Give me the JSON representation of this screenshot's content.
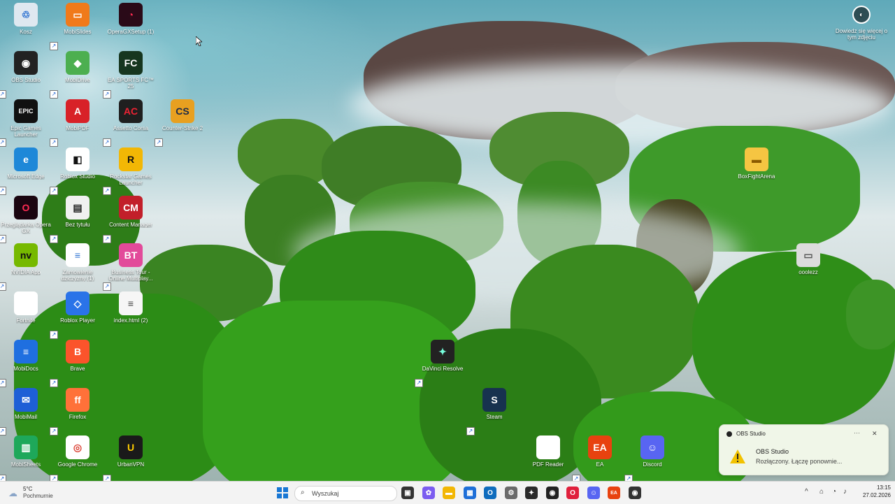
{
  "desktop": {
    "icons": [
      {
        "label": "Kosz",
        "badge": "♲",
        "bg": "#dfe8f0",
        "fg": "#2a6fd0",
        "shortcut": false
      },
      {
        "label": "MobiSlides",
        "badge": "▭",
        "bg": "#f07a1a",
        "fg": "#fff",
        "shortcut": true
      },
      {
        "label": "OperaGXSetup (1)",
        "badge": "◔",
        "bg": "#2a0a18",
        "fg": "#ff2b52",
        "shortcut": false
      },
      {
        "label": "OBS Studio",
        "badge": "◉",
        "bg": "#222",
        "fg": "#fff",
        "shortcut": true
      },
      {
        "label": "MobiDrive",
        "badge": "◆",
        "bg": "#4caf50",
        "fg": "#fff",
        "shortcut": true
      },
      {
        "label": "EA SPORTS FC™ 25",
        "badge": "FC",
        "bg": "#16361f",
        "fg": "#fff",
        "shortcut": true
      },
      {
        "label": "Epic Games Launcher",
        "badge": "EPIC",
        "bg": "#111",
        "fg": "#fff",
        "shortcut": true
      },
      {
        "label": "MobiPDF",
        "badge": "A",
        "bg": "#d82128",
        "fg": "#fff",
        "shortcut": true
      },
      {
        "label": "Assetto Corsa",
        "badge": "AC",
        "bg": "#1f1f1f",
        "fg": "#e23",
        "shortcut": true
      },
      {
        "label": "Counter-Strike 2",
        "badge": "CS",
        "bg": "#e8a020",
        "fg": "#1b2a4a",
        "shortcut": true
      },
      {
        "label": "Microsoft Edge",
        "badge": "e",
        "bg": "#1e88d8",
        "fg": "#fff",
        "shortcut": true
      },
      {
        "label": "Roblox Studio",
        "badge": "◧",
        "bg": "#fff",
        "fg": "#111",
        "shortcut": true
      },
      {
        "label": "Rockstar Games Launcher",
        "badge": "R",
        "bg": "#f2b705",
        "fg": "#111",
        "shortcut": true
      },
      {
        "label": "Przeglądarka Opera GX",
        "badge": "O",
        "bg": "#1a0510",
        "fg": "#ff2b52",
        "shortcut": true
      },
      {
        "label": "Bez tytułu",
        "badge": "▤",
        "bg": "#f0f0f0",
        "fg": "#222",
        "shortcut": true
      },
      {
        "label": "Content Manager",
        "badge": "CM",
        "bg": "#c21f2a",
        "fg": "#fff",
        "shortcut": true
      },
      {
        "label": "NVIDIA App",
        "badge": "nv",
        "bg": "#76b900",
        "fg": "#111",
        "shortcut": true
      },
      {
        "label": "Zamowienie dziczyzny (1)",
        "badge": "≡",
        "bg": "#ffffff",
        "fg": "#2a6fd0",
        "shortcut": false
      },
      {
        "label": "Business Tour - Online Multiplay...",
        "badge": "BT",
        "bg": "#e24a9a",
        "fg": "#fff",
        "shortcut": true
      },
      {
        "label": "Fortnite",
        "badge": "",
        "bg": "#ffffff",
        "fg": "#111",
        "shortcut": false
      },
      {
        "label": "Roblox Player",
        "badge": "◇",
        "bg": "#2a73e8",
        "fg": "#fff",
        "shortcut": true
      },
      {
        "label": "index.html (2)",
        "badge": "≡",
        "bg": "#f6f6f6",
        "fg": "#444",
        "shortcut": false
      },
      {
        "label": "MobiDocs",
        "badge": "≡",
        "bg": "#1f6fe0",
        "fg": "#fff",
        "shortcut": true
      },
      {
        "label": "Brave",
        "badge": "B",
        "bg": "#fb542b",
        "fg": "#fff",
        "shortcut": true
      },
      {
        "label": "MobiMail",
        "badge": "✉",
        "bg": "#1e5fd6",
        "fg": "#fff",
        "shortcut": true
      },
      {
        "label": "Firefox",
        "badge": "ff",
        "bg": "#ff7139",
        "fg": "#fff",
        "shortcut": true
      },
      {
        "label": "MobiSheets",
        "badge": "▥",
        "bg": "#1ea85a",
        "fg": "#fff",
        "shortcut": true
      },
      {
        "label": "Google Chrome",
        "badge": "◎",
        "bg": "#ffffff",
        "fg": "#db4437",
        "shortcut": true
      },
      {
        "label": "UrbanVPN",
        "badge": "U",
        "bg": "#1a1a1a",
        "fg": "#ffcc00",
        "shortcut": true
      },
      {
        "label": "DaVinci Resolve",
        "badge": "✦",
        "bg": "#222",
        "fg": "#7fd",
        "shortcut": true
      },
      {
        "label": "Steam",
        "badge": "S",
        "bg": "#17324f",
        "fg": "#fff",
        "shortcut": true
      },
      {
        "label": "PDF Reader",
        "badge": "",
        "bg": "#ffffff",
        "fg": "#111",
        "shortcut": false
      },
      {
        "label": "EA",
        "badge": "EA",
        "bg": "#e8420f",
        "fg": "#fff",
        "shortcut": true
      },
      {
        "label": "Discord",
        "badge": "☺",
        "bg": "#5865f2",
        "fg": "#fff",
        "shortcut": true
      },
      {
        "label": "BoxFightArena",
        "badge": "▬",
        "bg": "#f5c542",
        "fg": "#8a5a00",
        "shortcut": false
      },
      {
        "label": "ooolezz",
        "badge": "▭",
        "bg": "#dcdcdc",
        "fg": "#555",
        "shortcut": false
      }
    ],
    "learn_more": {
      "label": "Dowiedz się więcej o tym zdjęciu",
      "icon": "camera-icon"
    }
  },
  "notification": {
    "app_name": "OBS Studio",
    "title": "OBS Studio",
    "message": "Rozłączony. Łączę ponownie...",
    "more": "···",
    "close": "✕",
    "warning_color": "#f2c200"
  },
  "taskbar": {
    "weather_temp": "5°C",
    "weather_desc": "Pochmurnie",
    "search_placeholder": "Wyszukaj",
    "apps": [
      {
        "name": "task-view",
        "glyph": "▣",
        "bg": "#333"
      },
      {
        "name": "copilot",
        "glyph": "✿",
        "bg": "#7b5cf0"
      },
      {
        "name": "file-explorer",
        "glyph": "▬",
        "bg": "#f2b705"
      },
      {
        "name": "microsoft-store",
        "glyph": "▦",
        "bg": "#1e6fd8"
      },
      {
        "name": "outlook",
        "glyph": "O",
        "bg": "#0f6cbd"
      },
      {
        "name": "settings",
        "glyph": "⚙",
        "bg": "#6a6a6a"
      },
      {
        "name": "davinci-resolve",
        "glyph": "✦",
        "bg": "#2a2a2a"
      },
      {
        "name": "obs-studio",
        "glyph": "◉",
        "bg": "#222"
      },
      {
        "name": "opera-gx",
        "glyph": "O",
        "bg": "#e0203c"
      },
      {
        "name": "discord",
        "glyph": "☺",
        "bg": "#5865f2"
      },
      {
        "name": "ea",
        "glyph": "EA",
        "bg": "#e8420f"
      },
      {
        "name": "obs-alt",
        "glyph": "◉",
        "bg": "#333"
      }
    ],
    "time": "13:15",
    "date": "27.02.2026",
    "tray": {
      "chevron": "^",
      "network": "⌂",
      "wifi": "◔",
      "volume": "♪"
    }
  }
}
